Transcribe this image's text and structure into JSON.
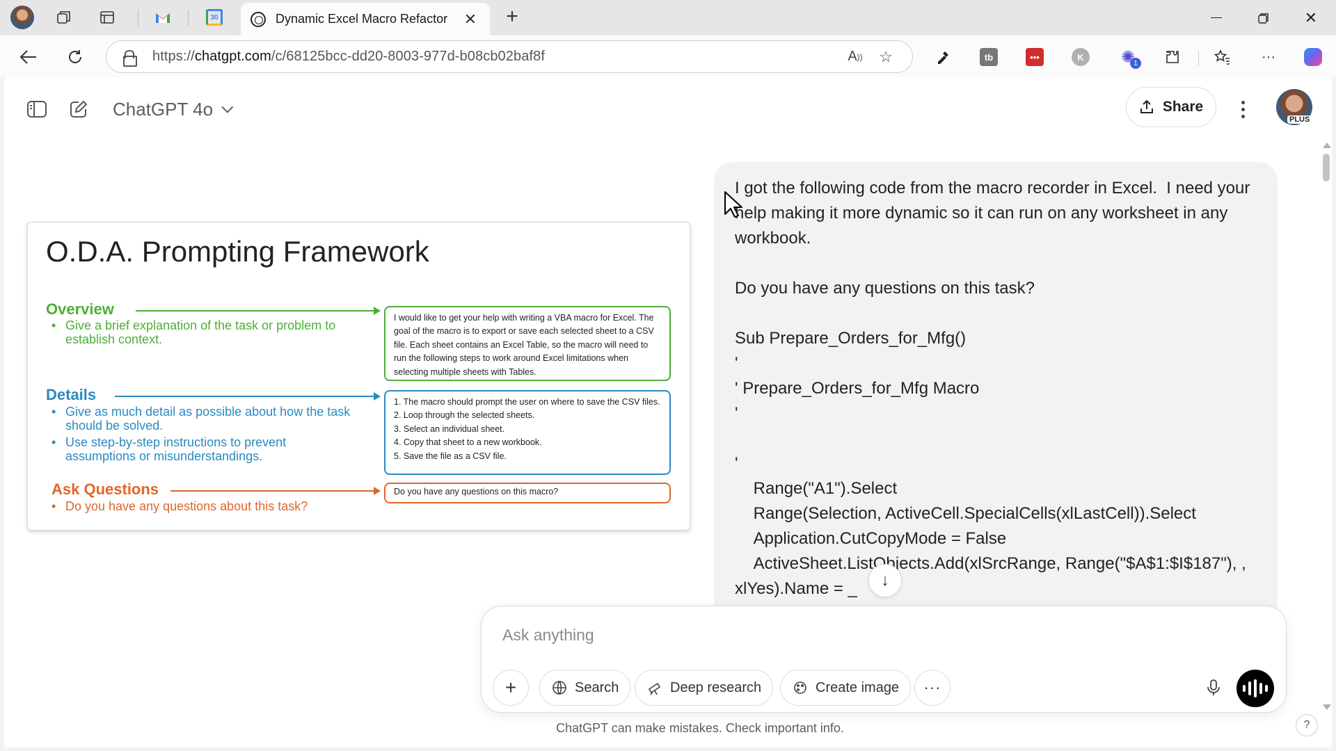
{
  "browser": {
    "active_tab_title": "Dynamic Excel Macro Refactor",
    "url_prefix": "https://",
    "url_domain": "chatgpt.com",
    "url_path": "/c/68125bcc-dd20-8003-977d-b08cb02baf8f",
    "extension_badge": "1"
  },
  "header": {
    "model_name": "ChatGPT 4o",
    "share_label": "Share",
    "plan_badge": "PLUS"
  },
  "framework_image": {
    "title": "O.D.A. Prompting Framework",
    "overview": {
      "heading": "Overview",
      "bullets": [
        "Give a brief explanation of the task or problem to establish context."
      ],
      "example": "I would like to get your help with writing a VBA macro for Excel. The goal of the macro is to export or save each selected sheet to a CSV file.  Each sheet contains an Excel Table, so the macro will need to run the following steps to work around Excel limitations when selecting multiple sheets with Tables."
    },
    "details": {
      "heading": "Details",
      "bullets": [
        "Give as much detail as possible about how the task should be solved.",
        "Use step-by-step instructions to prevent assumptions or misunderstandings."
      ],
      "example": [
        "1. The macro should prompt the user on where to save the CSV files.",
        "2. Loop through the selected sheets.",
        "3. Select an individual sheet.",
        "4. Copy that sheet to a new workbook.",
        "5. Save the file as a CSV file."
      ]
    },
    "ask": {
      "heading": "Ask Questions",
      "bullets": [
        "Do you have any questions about this task?"
      ],
      "example": "Do you have any questions on this macro?"
    }
  },
  "user_message": {
    "intro": "I got the following code from the macro recorder in Excel.  I need your help making it more dynamic so it can run on any worksheet in any workbook.",
    "question": "Do you have any questions on this task?",
    "code_lines": [
      "Sub Prepare_Orders_for_Mfg()",
      "'",
      "' Prepare_Orders_for_Mfg Macro",
      "'",
      "",
      "'",
      "    Range(\"A1\").Select",
      "    Range(Selection, ActiveCell.SpecialCells(xlLastCell)).Select",
      "    Application.CutCopyMode = False",
      "    ActiveSheet.ListObjects.Add(xlSrcRange, Range(\"$A$1:$I$187\"), ,",
      "xlYes).Name = _"
    ]
  },
  "composer": {
    "placeholder": "Ask anything",
    "search_label": "Search",
    "deep_research_label": "Deep research",
    "create_image_label": "Create image"
  },
  "footer": {
    "disclaimer": "ChatGPT can make mistakes. Check important info.",
    "help": "?"
  }
}
